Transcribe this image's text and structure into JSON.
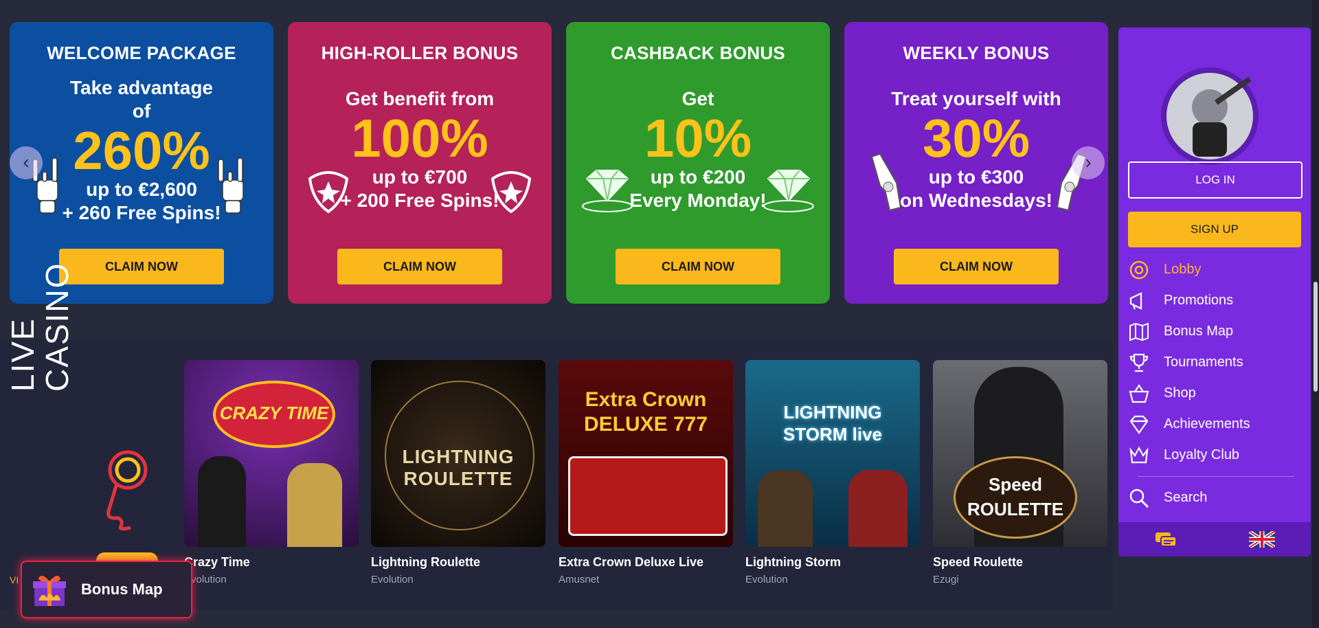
{
  "promos": [
    {
      "title": "WELCOME PACKAGE",
      "lead1": "Take advantage",
      "lead2": "of",
      "big": "260%",
      "sub1": "up to €2,600",
      "sub2": "+ 260 Free Spins!",
      "cta": "CLAIM NOW"
    },
    {
      "title": "HIGH-ROLLER BONUS",
      "lead1": "",
      "lead2": "Get benefit from",
      "big": "100%",
      "sub1": "up to €700",
      "sub2": "+ 200 Free Spins!",
      "cta": "CLAIM NOW"
    },
    {
      "title": "CASHBACK BONUS",
      "lead1": "",
      "lead2": "Get",
      "big": "10%",
      "sub1": "up to €200",
      "sub2": "Every Monday!",
      "cta": "CLAIM NOW"
    },
    {
      "title": "WEEKLY BONUS",
      "lead1": "",
      "lead2": "Treat yourself with",
      "big": "30%",
      "sub1": "up to €300",
      "sub2": "on Wednesdays!",
      "cta": "CLAIM NOW"
    }
  ],
  "carousel": {
    "prev": "‹",
    "next": "›"
  },
  "live": {
    "title_line1": "LIVE",
    "title_line2": "CASINO",
    "view_all": "VI"
  },
  "games": [
    {
      "name": "Crazy Time",
      "provider": "Evolution",
      "thumb_text": "CRAZY TIME"
    },
    {
      "name": "Lightning Roulette",
      "provider": "Evolution",
      "thumb_text": "LIGHTNING ROULETTE"
    },
    {
      "name": "Extra Crown Deluxe Live",
      "provider": "Amusnet",
      "thumb_text": "Extra Crown DELUXE 777"
    },
    {
      "name": "Lightning Storm",
      "provider": "Evolution",
      "thumb_text": "LIGHTNING STORM live"
    },
    {
      "name": "Speed Roulette",
      "provider": "Ezugi",
      "thumb_text": "Speed ROULETTE"
    }
  ],
  "sidebar": {
    "login": "LOG IN",
    "signup": "SIGN UP",
    "items": [
      {
        "label": "Lobby",
        "icon": "lobby-icon",
        "active": true
      },
      {
        "label": "Promotions",
        "icon": "megaphone-icon"
      },
      {
        "label": "Bonus Map",
        "icon": "map-icon"
      },
      {
        "label": "Tournaments",
        "icon": "trophy-icon"
      },
      {
        "label": "Shop",
        "icon": "basket-icon"
      },
      {
        "label": "Achievements",
        "icon": "diamond-icon"
      },
      {
        "label": "Loyalty Club",
        "icon": "crown-icon"
      }
    ],
    "search": "Search"
  },
  "bonus_fab": {
    "label": "Bonus Map"
  },
  "colors": {
    "accent": "#fbb81c",
    "sidebar": "#7a2be0",
    "blue": "#0c4fa1",
    "pink": "#b42259",
    "green": "#2f9b2d",
    "purple": "#7620c7"
  }
}
